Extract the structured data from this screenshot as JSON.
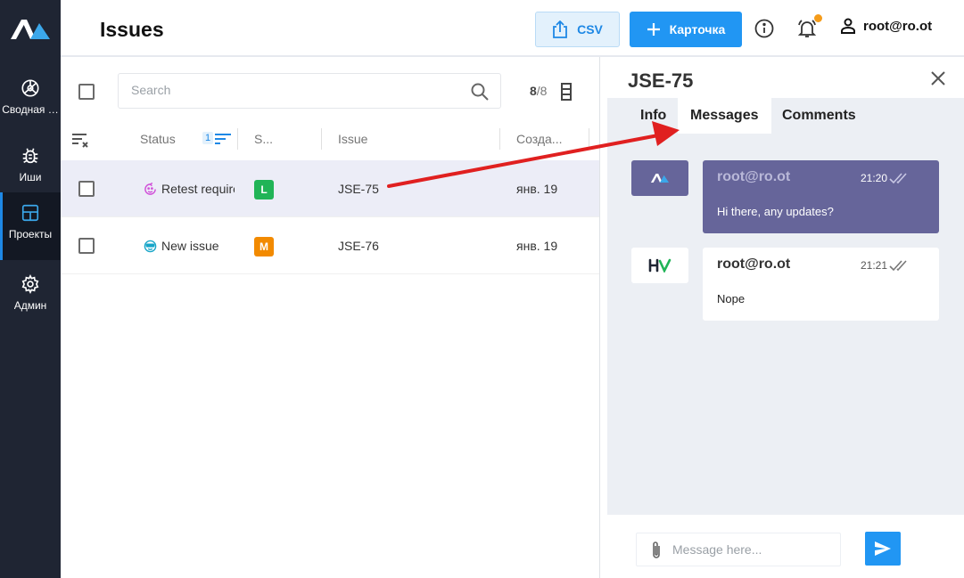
{
  "header": {
    "title": "Issues",
    "csv_label": "CSV",
    "card_label": "Карточка",
    "user": "root@ro.ot"
  },
  "sidebar": {
    "items": [
      {
        "label": "Сводная …",
        "icon": "dashboard-icon"
      },
      {
        "label": "Иши",
        "icon": "bug-icon"
      },
      {
        "label": "Проекты",
        "icon": "projects-icon",
        "active": true
      },
      {
        "label": "Админ",
        "icon": "gear-icon"
      }
    ]
  },
  "list": {
    "search_placeholder": "Search",
    "count_shown": "8",
    "count_total": "/8",
    "columns": {
      "status": "Status",
      "sort_index": "1",
      "size": "S...",
      "issue": "Issue",
      "created": "Созда..."
    },
    "rows": [
      {
        "status": "Retest required",
        "status_icon": "retest-icon",
        "status_color": "#d04fd8",
        "size": "L",
        "size_color": "#21b457",
        "key": "JSE-75",
        "created": "янв. 19",
        "selected": true
      },
      {
        "status": "New issue",
        "status_icon": "new-issue-icon",
        "status_color": "#17a5c8",
        "size": "M",
        "size_color": "#f28a00",
        "key": "JSE-76",
        "created": "янв. 19",
        "selected": false
      }
    ]
  },
  "detail": {
    "title": "JSE-75",
    "tabs": [
      "Info",
      "Messages",
      "Comments"
    ],
    "active_tab": "Messages",
    "messages": [
      {
        "author": "root@ro.ot",
        "time": "21:20",
        "text": "Hi there, any updates?",
        "own": true,
        "bubble_color": "#66659a"
      },
      {
        "author": "root@ro.ot",
        "time": "21:21",
        "text": "Nope",
        "own": false,
        "bubble_color": "#ffffff"
      }
    ],
    "composer_placeholder": "Message here..."
  },
  "colors": {
    "sidebar_bg": "#1f2533",
    "accent": "#2196f3",
    "annotation_arrow": "#e02020"
  }
}
